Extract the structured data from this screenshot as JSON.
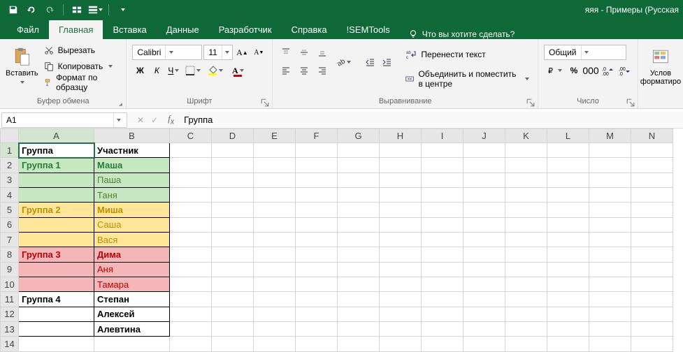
{
  "app": {
    "title": "яяя - Примеры (Русская"
  },
  "tabs": {
    "file": "Файл",
    "home": "Главная",
    "insert": "Вставка",
    "data": "Данные",
    "developer": "Разработчик",
    "help": "Справка",
    "semtools": "!SEMTools",
    "tellme": "Что вы хотите сделать?"
  },
  "ribbon": {
    "paste": "Вставить",
    "cut": "Вырезать",
    "copy": "Копировать",
    "format_painter": "Формат по образцу",
    "clipboard_group": "Буфер обмена",
    "font_name": "Calibri",
    "font_size": "11",
    "font_group": "Шрифт",
    "wrap": "Перенести текст",
    "merge": "Объединить и поместить в центре",
    "align_group": "Выравнивание",
    "number_format": "Общий",
    "number_group": "Число",
    "cond_fmt_l1": "Услов",
    "cond_fmt_l2": "форматиро"
  },
  "namebox": {
    "ref": "A1",
    "formula": "Группа"
  },
  "columns": [
    "A",
    "B",
    "C",
    "D",
    "E",
    "F",
    "G",
    "H",
    "I",
    "J",
    "K",
    "L",
    "M",
    "N"
  ],
  "headers": {
    "A": "Группа",
    "B": "Участник"
  },
  "rows": [
    {
      "n": 1,
      "A": "Группа",
      "B": "Участник",
      "style": "hdr"
    },
    {
      "n": 2,
      "A": "Группа 1",
      "B": "Маша",
      "fill": "green",
      "txtA": "txt-green",
      "txtB": "txt-green"
    },
    {
      "n": 3,
      "A": "",
      "B": "Паша",
      "fill": "green",
      "txtB": "txt-green2"
    },
    {
      "n": 4,
      "A": "",
      "B": "Таня",
      "fill": "green",
      "txtB": "txt-green2"
    },
    {
      "n": 5,
      "A": "Группа 2",
      "B": "Миша",
      "fill": "yellow",
      "txtA": "txt-orange",
      "txtB": "txt-orange"
    },
    {
      "n": 6,
      "A": "",
      "B": "Саша",
      "fill": "yellow",
      "txtB": "txt-orange2"
    },
    {
      "n": 7,
      "A": "",
      "B": "Вася",
      "fill": "yellow",
      "txtB": "txt-orange2"
    },
    {
      "n": 8,
      "A": "Группа 3",
      "B": "Дима",
      "fill": "pink",
      "txtA": "txt-red",
      "txtB": "txt-red"
    },
    {
      "n": 9,
      "A": "",
      "B": "Аня",
      "fill": "pink",
      "txtB": "txt-red2"
    },
    {
      "n": 10,
      "A": "",
      "B": "Тамара",
      "fill": "pink",
      "txtB": "txt-red2"
    },
    {
      "n": 11,
      "A": "Группа 4",
      "B": "Степан",
      "txtA": "bold",
      "txtB": "bold"
    },
    {
      "n": 12,
      "A": "",
      "B": "Алексей",
      "txtB": "bold"
    },
    {
      "n": 13,
      "A": "",
      "B": "Алевтина",
      "txtB": "bold"
    },
    {
      "n": 14,
      "A": "",
      "B": "",
      "nodata": true
    }
  ]
}
